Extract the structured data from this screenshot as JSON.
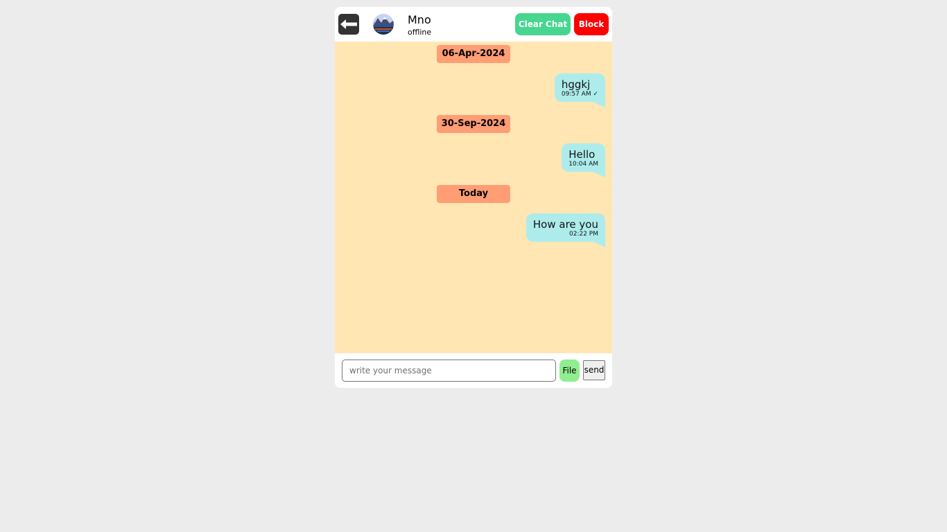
{
  "header": {
    "contact_name": "Mno",
    "contact_status": "offline",
    "clear_chat_label": "Clear Chat",
    "block_label": "Block",
    "back_icon": "arrow-left-icon",
    "avatar": "contact-avatar"
  },
  "colors": {
    "clear_chat": "#46d68f",
    "block": "#ff0000",
    "chat_background": "#ffe6b3",
    "date_badge": "#ff9d75",
    "outgoing_bubble": "#aeecec",
    "file_button": "#90ee90"
  },
  "messages": {
    "groups": [
      {
        "date": "06-Apr-2024",
        "items": [
          {
            "text": "hggkj",
            "time": "09:57 AM ✓"
          }
        ]
      },
      {
        "date": "30-Sep-2024",
        "items": [
          {
            "text": "Hello",
            "time": "10:04 AM"
          }
        ]
      },
      {
        "date": "Today",
        "items": [
          {
            "text": "How are you",
            "time": "02:22 PM"
          }
        ]
      }
    ]
  },
  "composer": {
    "placeholder": "write your message",
    "value": "",
    "file_label": "File",
    "send_label": "send"
  }
}
